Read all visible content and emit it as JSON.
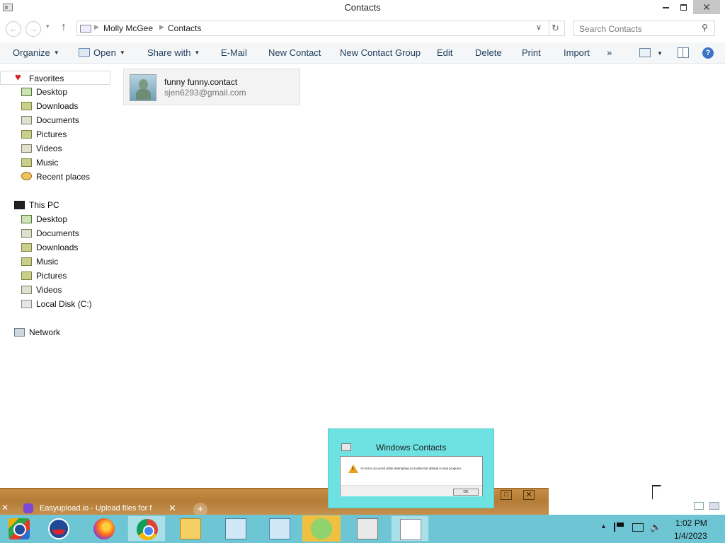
{
  "window": {
    "title": "Contacts",
    "minimize_glyph": "",
    "maximize_glyph": "",
    "close_glyph": "✕"
  },
  "address": {
    "crumbs": [
      "Molly McGee",
      "Contacts"
    ],
    "search_placeholder": "Search Contacts"
  },
  "toolbar": {
    "organize": "Organize",
    "open": "Open",
    "share_with": "Share with",
    "email": "E-Mail",
    "new_contact": "New Contact",
    "new_contact_group": "New Contact Group",
    "edit": "Edit",
    "delete": "Delete",
    "print": "Print",
    "import": "Import",
    "more": "»",
    "help": "?"
  },
  "navpane": {
    "favorites": {
      "label": "Favorites",
      "items": [
        "Desktop",
        "Downloads",
        "Documents",
        "Pictures",
        "Videos",
        "Music",
        "Recent places"
      ]
    },
    "this_pc": {
      "label": "This PC",
      "items": [
        "Desktop",
        "Documents",
        "Downloads",
        "Music",
        "Pictures",
        "Videos",
        "Local Disk (C:)"
      ]
    },
    "network": {
      "label": "Network"
    }
  },
  "contacts": [
    {
      "name": "funny funny.contact",
      "email": "sjen6293@gmail.com"
    }
  ],
  "dialog": {
    "title": "Windows Contacts",
    "message": "An error occurred while attempting to invoke the default e-mail program.",
    "ok": "OK"
  },
  "browser": {
    "tab_title": "Easyupload.io - Upload files for f",
    "tab_close": "✕",
    "new_tab": "+",
    "close_x": "✕"
  },
  "taskbar": {
    "apps": [
      "chrome-profile-icon",
      "obama-icon",
      "firefox-icon",
      "chrome-icon",
      "file-explorer-icon",
      "network-setup-icon",
      "network-setup-icon-2",
      "people-icon",
      "screen-icon",
      "document-icon"
    ],
    "time": "1:02 PM",
    "date": "1/4/2023"
  },
  "colors": {
    "taskbar": "#6ec6d4",
    "dialog": "#6ee2e3",
    "accent": "#1e3e5c"
  }
}
